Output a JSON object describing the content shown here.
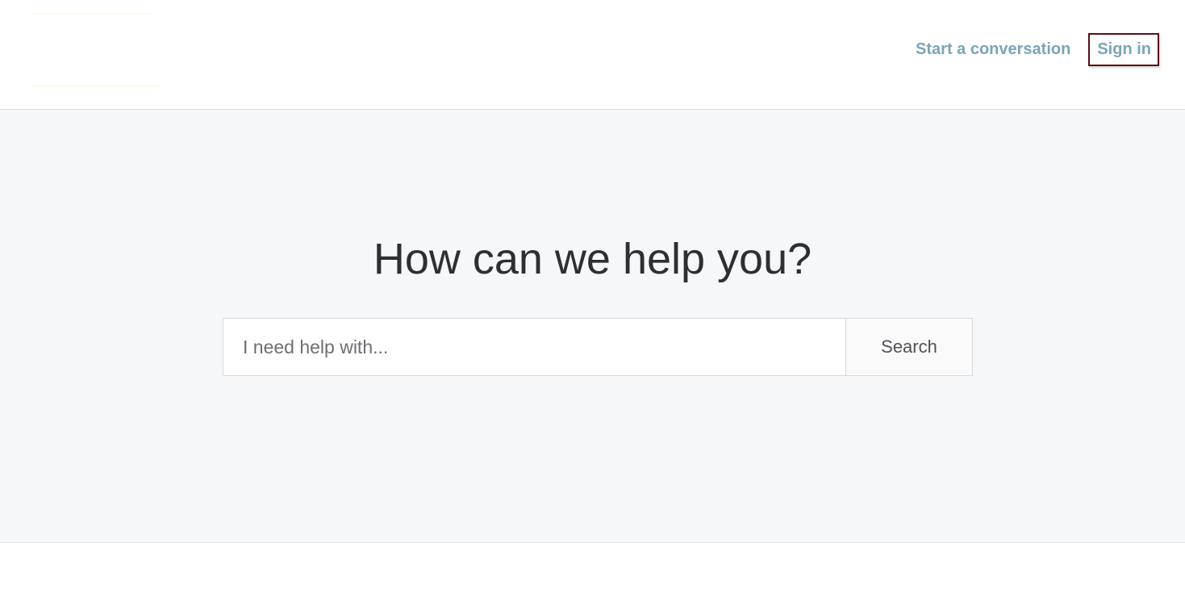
{
  "header": {
    "nav": {
      "start_conversation": "Start a conversation",
      "sign_in": "Sign in"
    }
  },
  "hero": {
    "title": "How can we help you?",
    "search": {
      "placeholder": "I need help with...",
      "value": "",
      "button_label": "Search"
    }
  },
  "colors": {
    "link": "#7aa4b8",
    "focus_outline": "#5b0f15",
    "hero_background": "#f6f7f9",
    "title_text": "#2d2f33"
  }
}
